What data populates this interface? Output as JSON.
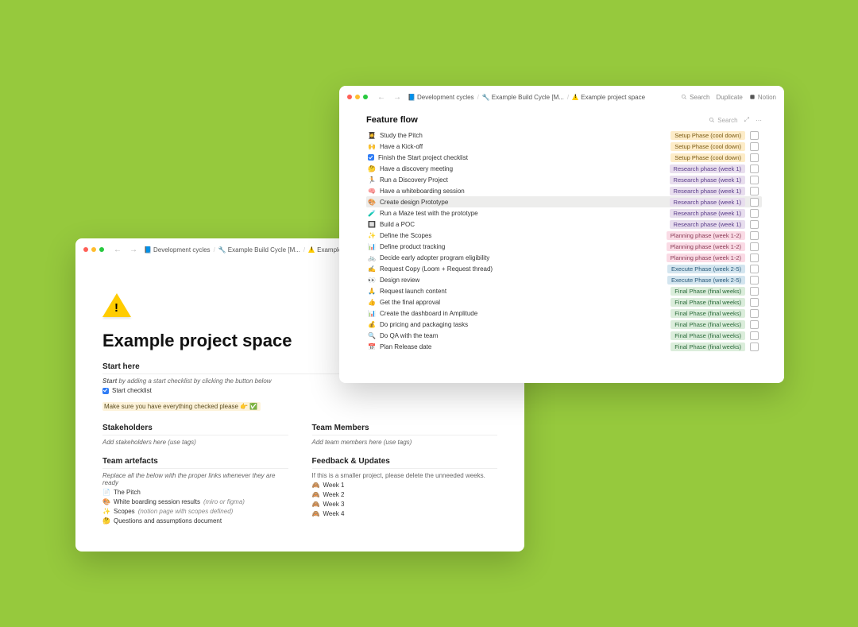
{
  "breadcrumbs": [
    {
      "icon": "📘",
      "label": "Development cycles"
    },
    {
      "icon": "🔧",
      "label": "Example Build Cycle [M..."
    },
    {
      "icon": "⚠️",
      "label": "Example project space"
    }
  ],
  "toolbar": {
    "search": "Search",
    "duplicate": "Duplicate",
    "notion": "Notion"
  },
  "page": {
    "title": "Example project space",
    "start_here": {
      "heading": "Start here",
      "hint_prefix": "Start",
      "hint_rest": " by adding a start checklist by clicking the button below",
      "checklist_label": "Start checklist",
      "highlight": "Make sure you have everything checked please 👉 ✅"
    },
    "stakeholders": {
      "heading": "Stakeholders",
      "hint": "Add stakeholders here (use tags)"
    },
    "team": {
      "heading": "Team Members",
      "hint": "Add team members here (use tags)"
    },
    "artefacts": {
      "heading": "Team artefacts",
      "hint": "Replace all the below with the proper links whenever they are ready",
      "items": [
        {
          "icon": "📄",
          "label": "The Pitch"
        },
        {
          "icon": "🎨",
          "label": "White boarding session results",
          "sub": "(miro or figma)"
        },
        {
          "icon": "✨",
          "label": "Scopes",
          "sub": "(notion page with scopes defined)"
        },
        {
          "icon": "🤔",
          "label": "Questions and assumptions document"
        }
      ]
    },
    "feedback": {
      "heading": "Feedback & Updates",
      "hint": "If this is a smaller project, please delete the unneeded weeks.",
      "items": [
        {
          "icon": "🙈",
          "label": "Week 1"
        },
        {
          "icon": "🙈",
          "label": "Week 2"
        },
        {
          "icon": "🙈",
          "label": "Week 3"
        },
        {
          "icon": "🙈",
          "label": "Week 4"
        }
      ]
    }
  },
  "feature_flow": {
    "title": "Feature flow",
    "search": "Search",
    "phases": {
      "setup": {
        "label": "Setup Phase (cool down)",
        "class": "yellow"
      },
      "research": {
        "label": "Research phase (week 1)",
        "class": "purple"
      },
      "planning": {
        "label": "Planning phase (week 1-2)",
        "class": "pink"
      },
      "execute": {
        "label": "Execute Phase (week 2-5)",
        "class": "blue"
      },
      "final": {
        "label": "Final Phase (final weeks)",
        "class": "green"
      }
    },
    "rows": [
      {
        "icon": "👩‍🎓",
        "label": "Study the Pitch",
        "phase": "setup",
        "checked": false
      },
      {
        "icon": "🙌",
        "label": "Have a Kick-off",
        "phase": "setup",
        "checked": false
      },
      {
        "icon": "✅",
        "label": "Finish the Start project checklist",
        "phase": "setup",
        "checked": false,
        "checkedIcon": true
      },
      {
        "icon": "🤔",
        "label": "Have a discovery meeting",
        "phase": "research",
        "checked": false
      },
      {
        "icon": "🏃",
        "label": "Run a Discovery Project",
        "phase": "research",
        "checked": false
      },
      {
        "icon": "🧠",
        "label": "Have a whiteboarding session",
        "phase": "research",
        "checked": false
      },
      {
        "icon": "🎨",
        "label": "Create design Prototype",
        "phase": "research",
        "checked": false,
        "selected": true
      },
      {
        "icon": "🧪",
        "label": "Run a Maze test with the prototype",
        "phase": "research",
        "checked": false
      },
      {
        "icon": "🔲",
        "label": "Build a POC",
        "phase": "research",
        "checked": false
      },
      {
        "icon": "✨",
        "label": "Define the Scopes",
        "phase": "planning",
        "checked": false
      },
      {
        "icon": "📊",
        "label": "Define product tracking",
        "phase": "planning",
        "checked": false
      },
      {
        "icon": "🚲",
        "label": "Decide early adopter program eligibility",
        "phase": "planning",
        "checked": false
      },
      {
        "icon": "✍️",
        "label": "Request Copy (Loom + Request thread)",
        "phase": "execute",
        "checked": false
      },
      {
        "icon": "👀",
        "label": "Design review",
        "phase": "execute",
        "checked": false
      },
      {
        "icon": "🙏",
        "label": "Request launch content",
        "phase": "final",
        "checked": false
      },
      {
        "icon": "👍",
        "label": "Get the final approval",
        "phase": "final",
        "checked": false
      },
      {
        "icon": "📊",
        "label": "Create the dashboard in Amplitude",
        "phase": "final",
        "checked": false
      },
      {
        "icon": "💰",
        "label": "Do pricing and packaging tasks",
        "phase": "final",
        "checked": false
      },
      {
        "icon": "🔍",
        "label": "Do QA with the team",
        "phase": "final",
        "checked": false
      },
      {
        "icon": "📅",
        "label": "Plan Release date",
        "phase": "final",
        "checked": false
      }
    ]
  }
}
